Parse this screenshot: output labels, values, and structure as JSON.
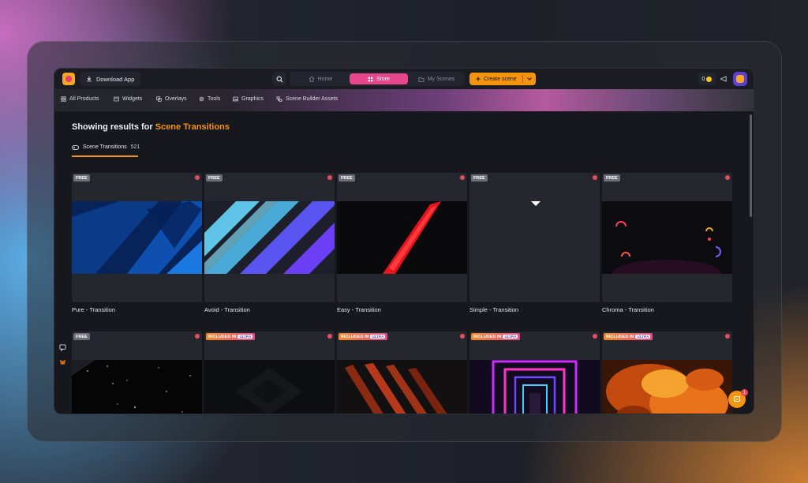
{
  "topbar": {
    "download_label": "Download App",
    "nav": {
      "home": "Home",
      "store": "Store",
      "my_scenes": "My Scenes"
    },
    "create_label": "Create scene",
    "coins": "0"
  },
  "categories": [
    "All Products",
    "Widgets",
    "Overlays",
    "Tools",
    "Graphics",
    "Scene Builder Assets"
  ],
  "results": {
    "prefix": "Showing results for ",
    "query": "Scene Transitions"
  },
  "filter": {
    "label": "Scene Transitions",
    "count": "521"
  },
  "badges": {
    "free": "FREE",
    "included": "INCLUDED IN",
    "ultra": "ULTRA"
  },
  "cards_row1": [
    {
      "name": "Pure - Transition"
    },
    {
      "name": "Avoid - Transition"
    },
    {
      "name": "Easy - Transition"
    },
    {
      "name": "Simple - Transition"
    },
    {
      "name": "Chroma - Transition"
    }
  ],
  "chat": {
    "badge_count": "1"
  },
  "colors": {
    "accent": "#f5940f",
    "store_active": "#e8478b",
    "brand_purple": "#5b3fd6"
  }
}
